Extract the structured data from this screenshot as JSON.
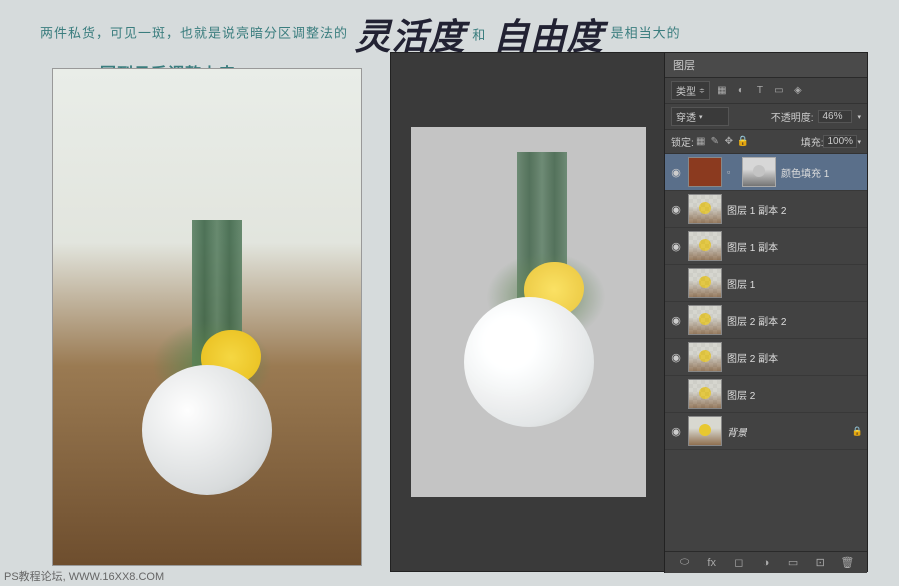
{
  "header": {
    "line1_a": "两件私货，可见一斑，也就是说亮暗分区调整法的",
    "big1": "灵活度",
    "connector": "和",
    "big2": "自由度",
    "line1_b": "是相当大的",
    "line2": "回到日系调整上来"
  },
  "panel": {
    "tab": "图层",
    "kind_label": "类型",
    "blend_mode": "穿透",
    "opacity_label": "不透明度:",
    "opacity_value": "46%",
    "lock_label": "锁定:",
    "fill_label": "填充:",
    "fill_value": "100%"
  },
  "layers": [
    {
      "name": "颜色填充 1",
      "selected": true,
      "color_fill": true,
      "mask": true
    },
    {
      "name": "图层 1 副本 2",
      "checker": true,
      "eye": true
    },
    {
      "name": "图层 1 副本",
      "checker": true,
      "eye": true
    },
    {
      "name": "图层 1",
      "checker": true
    },
    {
      "name": "图层 2 副本 2",
      "checker": true,
      "eye": true
    },
    {
      "name": "图层 2 副本",
      "checker": true,
      "eye": true
    },
    {
      "name": "图层 2",
      "checker": true
    },
    {
      "name": "背景",
      "locked": true,
      "eye": true
    }
  ],
  "icons": {
    "eye": "◉",
    "link": "⬚",
    "lock": "🔒",
    "chevron": "▾",
    "fx": "fx",
    "mask": "◐",
    "folder": "□",
    "adjust": "◑",
    "new": "⊞",
    "trash": "🗑"
  },
  "footer": "PS教程论坛, WWW.16XX8.COM"
}
